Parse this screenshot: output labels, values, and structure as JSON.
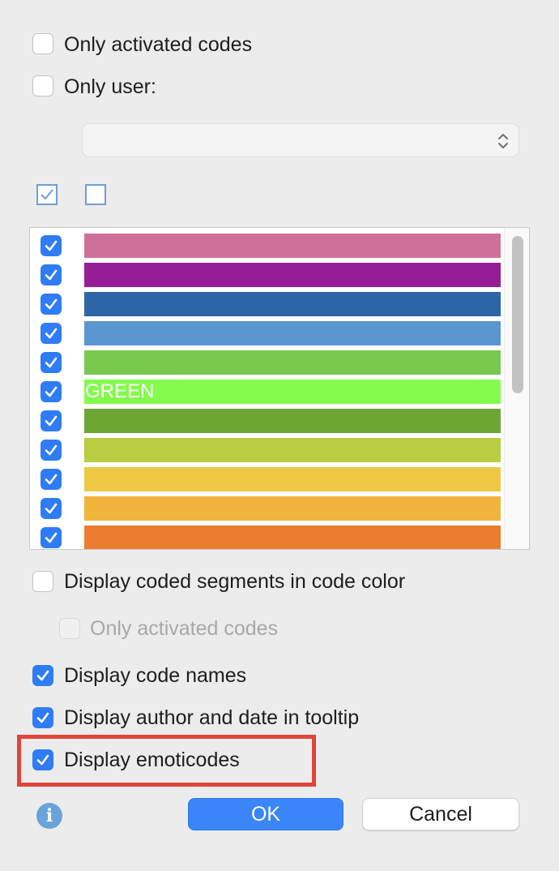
{
  "filters": {
    "only_activated_codes": {
      "label": "Only activated codes",
      "checked": false
    },
    "only_user": {
      "label": "Only user:",
      "checked": false
    },
    "user_select": {
      "value": ""
    }
  },
  "codes_list": {
    "items": [
      {
        "label": "",
        "color": "#CF7099",
        "checked": true
      },
      {
        "label": "",
        "color": "#951E96",
        "checked": true
      },
      {
        "label": "",
        "color": "#2C66A6",
        "checked": true
      },
      {
        "label": "",
        "color": "#5A96D0",
        "checked": true
      },
      {
        "label": "",
        "color": "#79C94E",
        "checked": true
      },
      {
        "label": "GREEN",
        "color": "#84FB4E",
        "checked": true
      },
      {
        "label": "",
        "color": "#6DA632",
        "checked": true
      },
      {
        "label": "",
        "color": "#B8CD41",
        "checked": true
      },
      {
        "label": "",
        "color": "#EFC945",
        "checked": true
      },
      {
        "label": "",
        "color": "#F1B43D",
        "checked": true
      },
      {
        "label": "",
        "color": "#EC7C30",
        "checked": true
      }
    ]
  },
  "options": {
    "display_coded_segments": {
      "label": "Display coded segments in code color",
      "checked": false
    },
    "only_activated_codes_sub": {
      "label": "Only activated codes",
      "checked": false,
      "disabled": true
    },
    "display_code_names": {
      "label": "Display code names",
      "checked": true
    },
    "display_author_date": {
      "label": "Display author and date in tooltip",
      "checked": true
    },
    "display_emoticodes": {
      "label": "Display emoticodes",
      "checked": true
    }
  },
  "buttons": {
    "ok": "OK",
    "cancel": "Cancel",
    "info_glyph": "i"
  },
  "colors": {
    "accent": "#2f7cf6",
    "highlight": "#e0443a"
  }
}
